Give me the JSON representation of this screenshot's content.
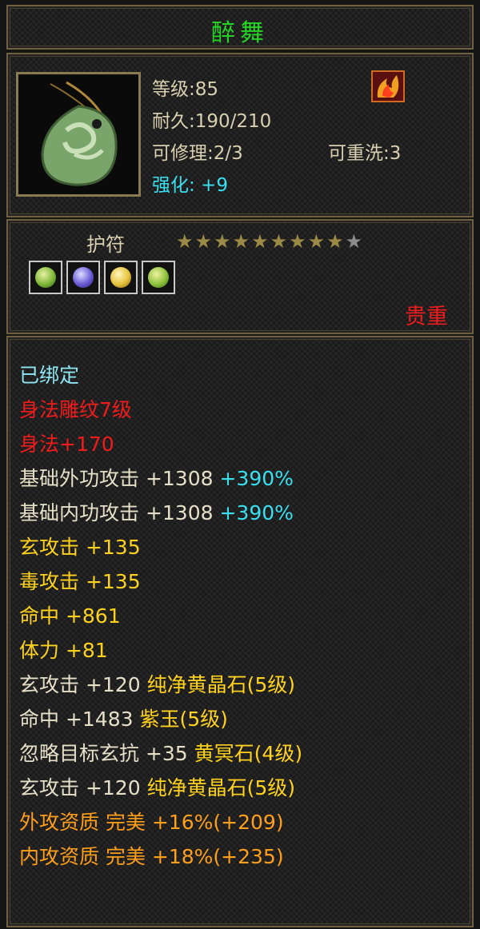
{
  "item": {
    "name": "醉舞",
    "level": "等级:85",
    "durability": "耐久:190/210",
    "repair": "可修理:2/3",
    "rewash": "可重洗:3",
    "enhance": "强化: +9",
    "type": "护符",
    "star_rating": {
      "filled": 9,
      "total": 10
    },
    "rarity": "贵重"
  },
  "colors": {
    "title": "#26d426",
    "default": "#d8d0b0",
    "cyan": "#8fe6f2",
    "red": "#f01c1c",
    "light": "#e6e0c8",
    "bonus": "#38e0f0",
    "gold": "#ffd21e",
    "orange": "#ff9f1a"
  },
  "stats": [
    {
      "segments": [
        {
          "text": "已绑定",
          "color": "cyan"
        }
      ]
    },
    {
      "segments": [
        {
          "text": "身法雕纹7级",
          "color": "red"
        }
      ]
    },
    {
      "segments": [
        {
          "text": "身法+170",
          "color": "red"
        }
      ]
    },
    {
      "segments": [
        {
          "text": "基础外功攻击 +1308 ",
          "color": "light"
        },
        {
          "text": "+390%",
          "color": "bonus"
        }
      ]
    },
    {
      "segments": [
        {
          "text": "基础内功攻击 +1308 ",
          "color": "light"
        },
        {
          "text": "+390%",
          "color": "bonus"
        }
      ]
    },
    {
      "segments": [
        {
          "text": "玄攻击 +135",
          "color": "gold"
        }
      ]
    },
    {
      "segments": [
        {
          "text": "毒攻击 +135",
          "color": "gold"
        }
      ]
    },
    {
      "segments": [
        {
          "text": "命中 +861",
          "color": "gold"
        }
      ]
    },
    {
      "segments": [
        {
          "text": "体力 +81",
          "color": "gold"
        }
      ]
    },
    {
      "segments": [
        {
          "text": "玄攻击 +120 ",
          "color": "light"
        },
        {
          "text": "纯净黄晶石(5级)",
          "color": "gold"
        }
      ]
    },
    {
      "segments": [
        {
          "text": "命中 +1483 ",
          "color": "light"
        },
        {
          "text": "紫玉(5级)",
          "color": "gold"
        }
      ]
    },
    {
      "segments": [
        {
          "text": "忽略目标玄抗 +35 ",
          "color": "light"
        },
        {
          "text": "黄冥石(4级)",
          "color": "gold"
        }
      ]
    },
    {
      "segments": [
        {
          "text": "玄攻击 +120 ",
          "color": "light"
        },
        {
          "text": "纯净黄晶石(5级)",
          "color": "gold"
        }
      ]
    },
    {
      "segments": [
        {
          "text": "外攻资质  完美 +16%(+209)",
          "color": "orange"
        }
      ]
    },
    {
      "segments": [
        {
          "text": "内攻资质  完美 +18%(+235)",
          "color": "orange"
        }
      ]
    }
  ],
  "gems": [
    {
      "icon": "green-gem-icon",
      "color": "#7fb83a"
    },
    {
      "icon": "purple-gem-icon",
      "color": "#6a5cd6"
    },
    {
      "icon": "yellow-gem-icon",
      "color": "#e6c23a"
    },
    {
      "icon": "green-gem-icon",
      "color": "#8cc23a"
    }
  ]
}
